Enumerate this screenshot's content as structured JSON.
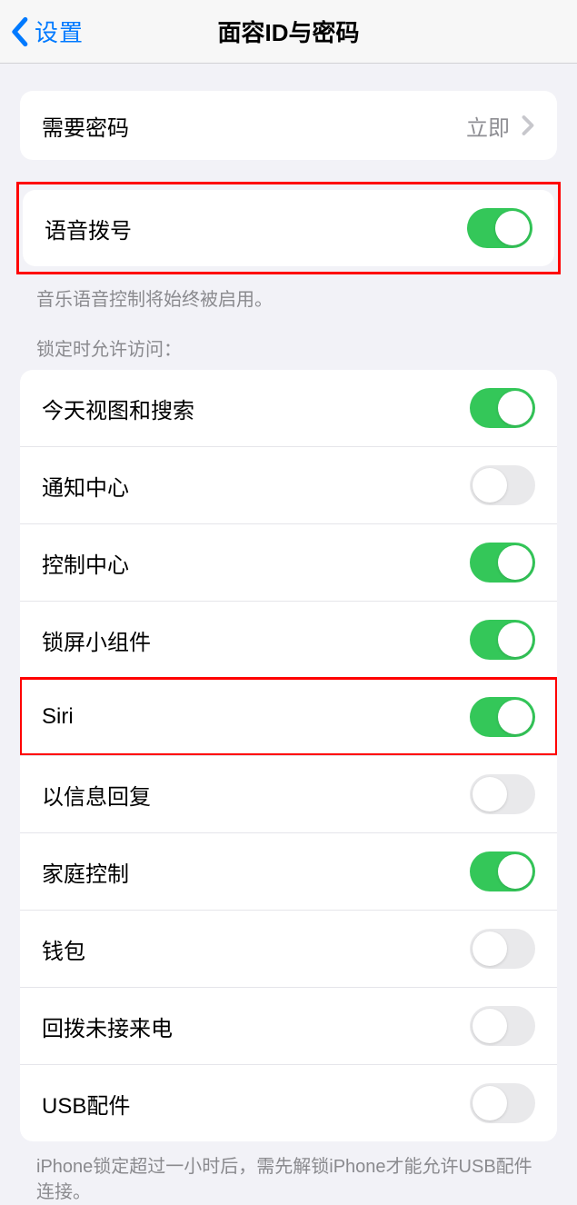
{
  "nav": {
    "back_label": "设置",
    "title": "面容ID与密码"
  },
  "passcode_section": {
    "require_passcode": {
      "label": "需要密码",
      "value": "立即"
    }
  },
  "voice_dial_section": {
    "voice_dial": {
      "label": "语音拨号",
      "on": true
    },
    "footer": "音乐语音控制将始终被启用。"
  },
  "lock_access_section": {
    "header": "锁定时允许访问：",
    "items": [
      {
        "label": "今天视图和搜索",
        "on": true
      },
      {
        "label": "通知中心",
        "on": false
      },
      {
        "label": "控制中心",
        "on": true
      },
      {
        "label": "锁屏小组件",
        "on": true
      },
      {
        "label": "Siri",
        "on": true
      },
      {
        "label": "以信息回复",
        "on": false
      },
      {
        "label": "家庭控制",
        "on": true
      },
      {
        "label": "钱包",
        "on": false
      },
      {
        "label": "回拨未接来电",
        "on": false
      },
      {
        "label": "USB配件",
        "on": false
      }
    ],
    "footer": "iPhone锁定超过一小时后，需先解锁iPhone才能允许USB配件连接。"
  }
}
